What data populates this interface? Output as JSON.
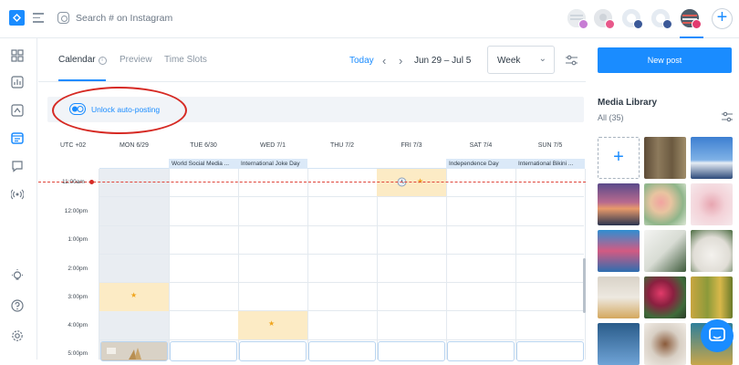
{
  "topbar": {
    "search_placeholder": "Search # on Instagram",
    "profiles": [
      {
        "name": "profile-1",
        "badge_color": "#c77dd4"
      },
      {
        "name": "profile-2",
        "badge_color": "#e8588a"
      },
      {
        "name": "profile-3",
        "badge_color": "#3b5998"
      },
      {
        "name": "profile-4",
        "badge_color": "#3b5998"
      },
      {
        "name": "profile-5",
        "badge_color": "#e23b6f"
      }
    ],
    "add_label": "+"
  },
  "header": {
    "tabs": [
      {
        "label": "Calendar",
        "active": true
      },
      {
        "label": "Preview",
        "active": false
      },
      {
        "label": "Time Slots",
        "active": false
      }
    ],
    "today_label": "Today",
    "date_range": "Jun 29 – Jul 5",
    "view_select": "Week"
  },
  "banner": {
    "text": "Unlock auto-posting"
  },
  "calendar": {
    "timezone": "UTC +02",
    "days": [
      "MON 6/29",
      "TUE 6/30",
      "WED 7/1",
      "THU 7/2",
      "FRI 7/3",
      "SAT 7/4",
      "SUN 7/5"
    ],
    "events": [
      {
        "day": 1,
        "label": "World Social Media ..."
      },
      {
        "day": 2,
        "label": "International Joke Day"
      },
      {
        "day": 5,
        "label": "Independence Day"
      },
      {
        "day": 6,
        "label": "International Bikini ..."
      }
    ],
    "current_time": "11:00am",
    "hours": [
      "12:00pm",
      "1:00pm",
      "2:00pm",
      "3:00pm",
      "4:00pm",
      "5:00pm"
    ],
    "starred_slots": [
      {
        "day": 4,
        "hour_index": 0
      },
      {
        "day": 0,
        "hour_index": 4
      },
      {
        "day": 2,
        "hour_index": 5
      }
    ]
  },
  "right_panel": {
    "new_post_label": "New post",
    "media_title": "Media Library",
    "media_count": "All (35)",
    "upload_label": "+"
  },
  "colors": {
    "accent": "#1a8cff",
    "slot_highlight": "#fcebc5",
    "annotation": "#d62a24"
  }
}
